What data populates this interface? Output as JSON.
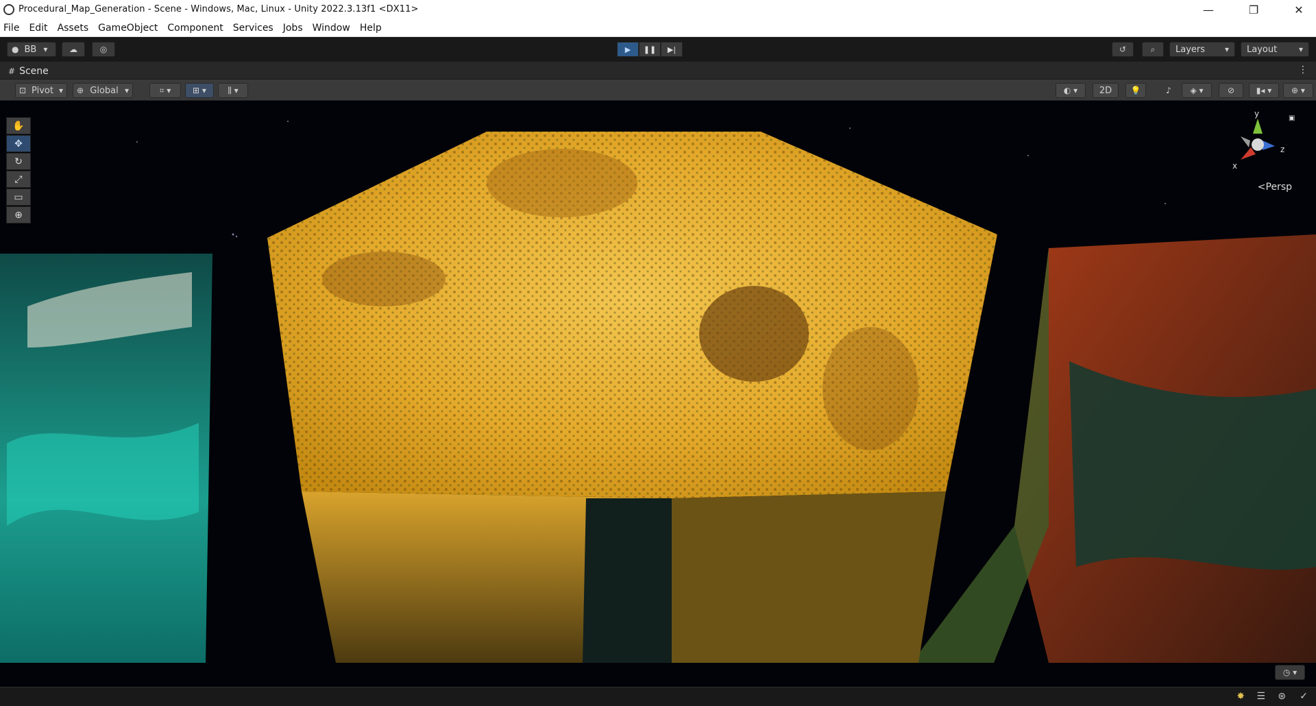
{
  "window": {
    "title": "Procedural_Map_Generation - Scene - Windows, Mac, Linux - Unity 2022.3.13f1 <DX11>",
    "minimize_glyph": "—",
    "maximize_glyph": "❐",
    "close_glyph": "✕"
  },
  "menubar": [
    "File",
    "Edit",
    "Assets",
    "GameObject",
    "Component",
    "Services",
    "Jobs",
    "Window",
    "Help"
  ],
  "toolbar": {
    "account_label": "BB",
    "layers_label": "Layers",
    "layout_label": "Layout"
  },
  "scene_tab": {
    "label": "Scene"
  },
  "scene_toolbar": {
    "pivot_label": "Pivot",
    "global_label": "Global",
    "mode_2d_label": "2D"
  },
  "viewport": {
    "axis_y": "y",
    "axis_x": "x",
    "axis_z": "z",
    "persp_label": "Persp"
  },
  "colors": {
    "editor_bg": "#191919",
    "play_active": "#2d5a8a",
    "terrain_sand": "#e9b533",
    "terrain_teal": "#1fa596",
    "terrain_red": "#8a2a14"
  }
}
